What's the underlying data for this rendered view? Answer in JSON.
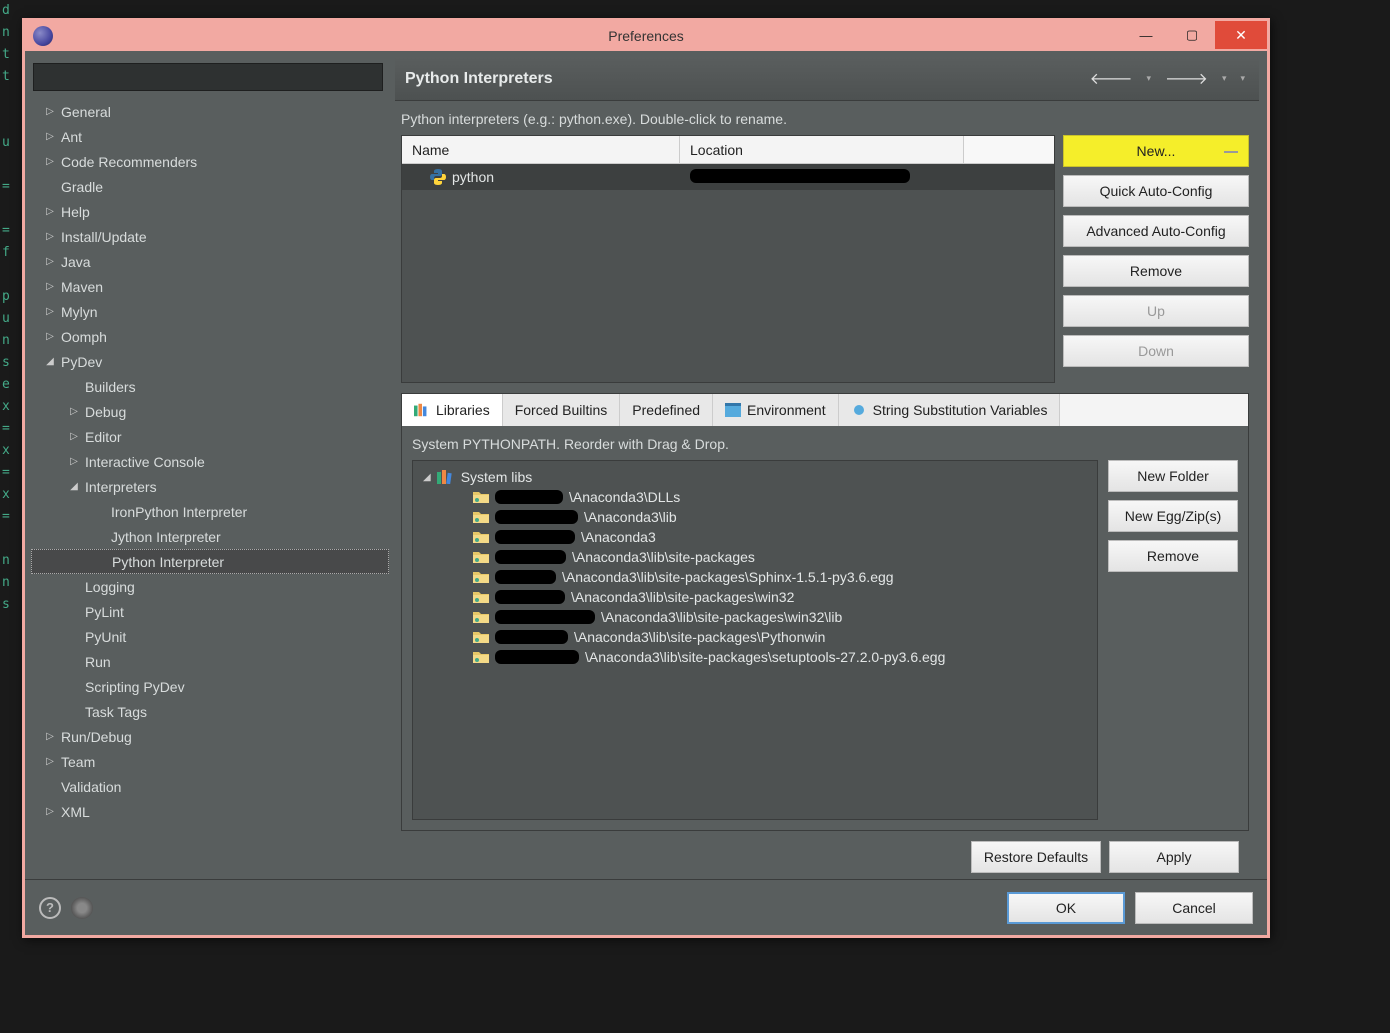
{
  "window": {
    "title": "Preferences"
  },
  "sidebar": {
    "items": [
      {
        "label": "General",
        "arrow": "▷",
        "indent": 0
      },
      {
        "label": "Ant",
        "arrow": "▷",
        "indent": 0
      },
      {
        "label": "Code Recommenders",
        "arrow": "▷",
        "indent": 0
      },
      {
        "label": "Gradle",
        "arrow": "",
        "indent": 0
      },
      {
        "label": "Help",
        "arrow": "▷",
        "indent": 0
      },
      {
        "label": "Install/Update",
        "arrow": "▷",
        "indent": 0
      },
      {
        "label": "Java",
        "arrow": "▷",
        "indent": 0
      },
      {
        "label": "Maven",
        "arrow": "▷",
        "indent": 0
      },
      {
        "label": "Mylyn",
        "arrow": "▷",
        "indent": 0
      },
      {
        "label": "Oomph",
        "arrow": "▷",
        "indent": 0
      },
      {
        "label": "PyDev",
        "arrow": "◢",
        "indent": 0
      },
      {
        "label": "Builders",
        "arrow": "",
        "indent": 1
      },
      {
        "label": "Debug",
        "arrow": "▷",
        "indent": 1
      },
      {
        "label": "Editor",
        "arrow": "▷",
        "indent": 1
      },
      {
        "label": "Interactive Console",
        "arrow": "▷",
        "indent": 1
      },
      {
        "label": "Interpreters",
        "arrow": "◢",
        "indent": 1
      },
      {
        "label": "IronPython Interpreter",
        "arrow": "",
        "indent": 2
      },
      {
        "label": "Jython Interpreter",
        "arrow": "",
        "indent": 2
      },
      {
        "label": "Python Interpreter",
        "arrow": "",
        "indent": 2,
        "selected": true
      },
      {
        "label": "Logging",
        "arrow": "",
        "indent": 1
      },
      {
        "label": "PyLint",
        "arrow": "",
        "indent": 1
      },
      {
        "label": "PyUnit",
        "arrow": "",
        "indent": 1
      },
      {
        "label": "Run",
        "arrow": "",
        "indent": 1
      },
      {
        "label": "Scripting PyDev",
        "arrow": "",
        "indent": 1
      },
      {
        "label": "Task Tags",
        "arrow": "",
        "indent": 1
      },
      {
        "label": "Run/Debug",
        "arrow": "▷",
        "indent": 0
      },
      {
        "label": "Team",
        "arrow": "▷",
        "indent": 0
      },
      {
        "label": "Validation",
        "arrow": "",
        "indent": 0
      },
      {
        "label": "XML",
        "arrow": "▷",
        "indent": 0
      }
    ]
  },
  "content": {
    "heading": "Python Interpreters",
    "hint": "Python interpreters (e.g.: python.exe).   Double-click to rename.",
    "table": {
      "headers": {
        "name": "Name",
        "location": "Location"
      },
      "rows": [
        {
          "name": "python"
        }
      ]
    },
    "buttons": {
      "new": "New...",
      "quick": "Quick Auto-Config",
      "advanced": "Advanced Auto-Config",
      "remove": "Remove",
      "up": "Up",
      "down": "Down"
    },
    "tabs": [
      {
        "label": "Libraries",
        "icon": "books",
        "active": true
      },
      {
        "label": "Forced Builtins"
      },
      {
        "label": "Predefined"
      },
      {
        "label": "Environment",
        "icon": "env"
      },
      {
        "label": "String Substitution Variables",
        "icon": "dot"
      }
    ],
    "tabHint": "System PYTHONPATH.   Reorder with Drag & Drop.",
    "libs": {
      "root": "System libs",
      "paths": [
        "\\Anaconda3\\DLLs",
        "\\Anaconda3\\lib",
        "\\Anaconda3",
        "\\Anaconda3\\lib\\site-packages",
        "\\Anaconda3\\lib\\site-packages\\Sphinx-1.5.1-py3.6.egg",
        "\\Anaconda3\\lib\\site-packages\\win32",
        "\\Anaconda3\\lib\\site-packages\\win32\\lib",
        "\\Anaconda3\\lib\\site-packages\\Pythonwin",
        "\\Anaconda3\\lib\\site-packages\\setuptools-27.2.0-py3.6.egg"
      ]
    },
    "libButtons": {
      "newFolder": "New Folder",
      "newEgg": "New Egg/Zip(s)",
      "remove": "Remove"
    },
    "restore": "Restore Defaults",
    "apply": "Apply"
  },
  "footer": {
    "ok": "OK",
    "cancel": "Cancel"
  }
}
